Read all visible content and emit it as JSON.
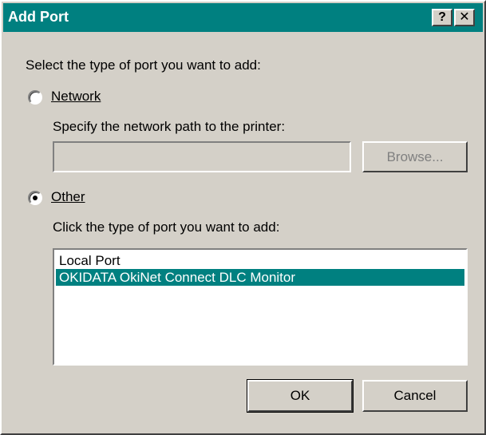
{
  "window": {
    "title": "Add Port",
    "help_glyph": "?",
    "close_glyph": "✕"
  },
  "dialog": {
    "prompt": "Select the type of port you want to add:",
    "network_option": {
      "label": "Network",
      "selected": false,
      "path_label": "Specify the network path to the printer:",
      "path_value": "",
      "browse_label": "Browse..."
    },
    "other_option": {
      "label": "Other",
      "selected": true,
      "list_label": "Click the type of port you want to add:",
      "ports": [
        "Local Port",
        "OKIDATA OkiNet Connect DLC Monitor"
      ],
      "selected_port": "OKIDATA OkiNet Connect DLC Monitor"
    },
    "ok_label": "OK",
    "cancel_label": "Cancel"
  },
  "colors": {
    "titlebar": "#008080",
    "selection": "#008080",
    "face": "#d4d0c8"
  }
}
